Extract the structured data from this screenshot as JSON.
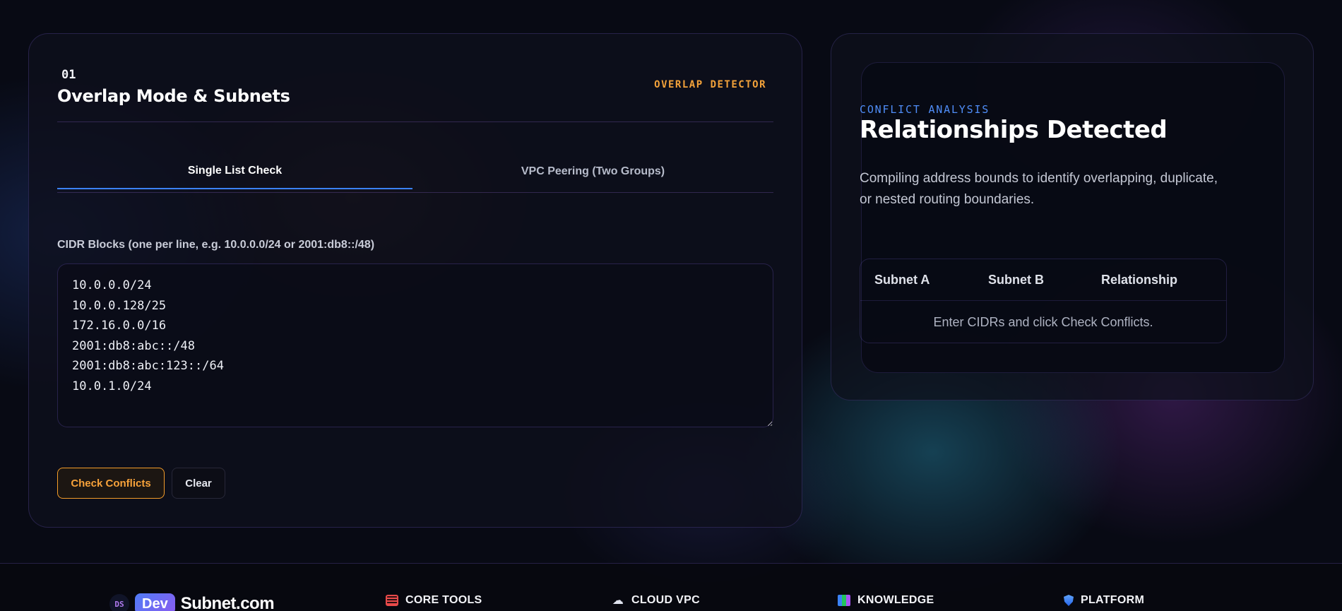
{
  "left_panel": {
    "step": "01",
    "title": "Overlap Mode & Subnets",
    "tag": "OVERLAP DETECTOR",
    "tabs": [
      {
        "label": "Single List Check",
        "active": true
      },
      {
        "label": "VPC Peering (Two Groups)",
        "active": false
      }
    ],
    "cidr_label": "CIDR Blocks (one per line, e.g. 10.0.0.0/24 or 2001:db8::/48)",
    "cidr_value": "10.0.0.0/24\n10.0.0.128/25\n172.16.0.0/16\n2001:db8:abc::/48\n2001:db8:abc:123::/64\n10.0.1.0/24",
    "check_button": "Check Conflicts",
    "clear_button": "Clear"
  },
  "right_panel": {
    "eyebrow": "CONFLICT ANALYSIS",
    "title": "Relationships Detected",
    "description": "Compiling address bounds to identify overlapping, duplicate, or nested routing boundaries.",
    "table": {
      "columns": [
        "Subnet A",
        "Subnet B",
        "Relationship"
      ],
      "empty_message": "Enter CIDRs and click Check Conflicts."
    }
  },
  "footer": {
    "logo_badge": "DS",
    "logo_dev": "Dev",
    "logo_name": "Subnet.com",
    "columns": [
      {
        "label": "CORE TOOLS",
        "icon": "core-tools-icon"
      },
      {
        "label": "CLOUD VPC",
        "icon": "cloud-icon"
      },
      {
        "label": "KNOWLEDGE",
        "icon": "books-icon"
      },
      {
        "label": "PLATFORM",
        "icon": "shield-icon"
      }
    ]
  },
  "colors": {
    "accent_orange": "#f39c2a",
    "accent_blue": "#3b82f6",
    "background": "#080a14"
  }
}
